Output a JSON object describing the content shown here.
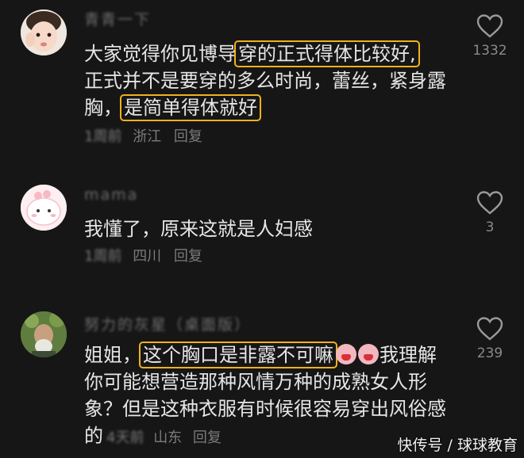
{
  "comments": [
    {
      "username": "青青一下",
      "text_pre": "大家觉得你见博导",
      "text_hl1": "穿的正式得体比较好,",
      "text_mid": "正式并不是要穿的多么时尚，蕾丝，紧身露胸，",
      "text_hl2": "是简单得体就好",
      "time": "1周前",
      "location": "浙江",
      "reply": "回复",
      "likes": "1332"
    },
    {
      "username": "mama",
      "text": "我懂了，原来这就是人妇感",
      "time": "1周前",
      "location": "四川",
      "reply": "回复",
      "likes": "3"
    },
    {
      "username": "努力的灰星（桌面版）",
      "text_pre": "姐姐，",
      "text_hl": "这个胸口是非露不可嘛",
      "text_post": "我理解你可能想营造那种风情万种的成熟女人形象？但是这种衣服有时候很容易穿出风俗感的",
      "time": "4天前",
      "location": "山东",
      "reply": "回复",
      "likes": "239"
    }
  ],
  "watermark": "快传号 / 球球教育",
  "colors": {
    "background": "#161616",
    "highlight": "#f0b21b",
    "meta": "#7b7b7b"
  },
  "icons": {
    "like": "heart-outline-icon",
    "emoji": "crying-face-emoji"
  }
}
